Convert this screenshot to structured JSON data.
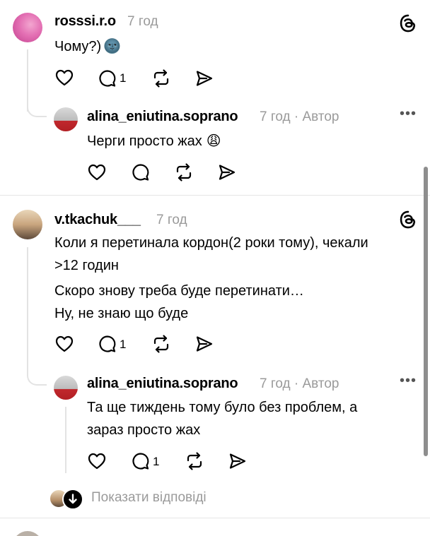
{
  "comments": [
    {
      "username": "rosssi.r.o",
      "time": "7 год",
      "text": "Чому?)",
      "emoji": "🌚",
      "reply_count": "1",
      "reply": {
        "username": "alina_eniutina.soprano",
        "time": "7 год · Автор",
        "text": "Черги просто жах",
        "emoji": "😩"
      }
    },
    {
      "username": "v.tkachuk___",
      "time": "7 год",
      "lines": [
        "Коли я перетинала кордон(2 роки тому), чекали",
        ">12 годин",
        "Скоро знову треба буде перетинати…",
        "Ну, не знаю що буде"
      ],
      "reply_count": "1",
      "reply": {
        "username": "alina_eniutina.soprano",
        "time": "7 год · Автор",
        "lines": [
          "Та ще тиждень тому було без проблем, а",
          "зараз просто жах"
        ],
        "reply_count": "1"
      },
      "show_replies": "Показати відповіді"
    }
  ],
  "icons": {
    "like": "heart-icon",
    "comment": "comment-icon",
    "repost": "repost-icon",
    "share": "share-icon",
    "threads": "threads-logo-icon",
    "more": "more-icon"
  }
}
